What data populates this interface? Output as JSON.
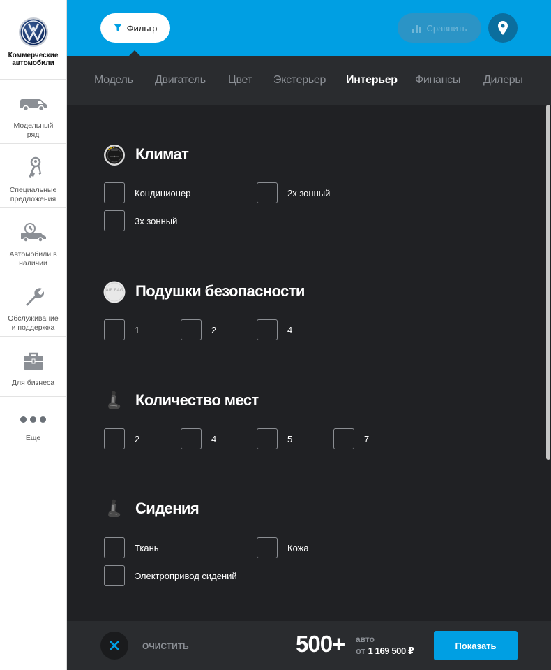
{
  "brand": {
    "name": "Коммерческие автомобили"
  },
  "sidebar": {
    "items": [
      {
        "label": "Модельный ряд",
        "icon": "van-icon"
      },
      {
        "label": "Специальные предложения",
        "icon": "keys-icon"
      },
      {
        "label": "Автомобили в наличии",
        "icon": "car-clock-icon"
      },
      {
        "label": "Обслуживание и поддержка",
        "icon": "wrench-icon"
      },
      {
        "label": "Для бизнеса",
        "icon": "briefcase-icon"
      },
      {
        "label": "Еще",
        "icon": "more-dots-icon"
      }
    ]
  },
  "topbar": {
    "filter_label": "Фильтр",
    "compare_label": "Сравнить",
    "accent_color": "#009fe3"
  },
  "tabs": [
    "Модель",
    "Двигатель",
    "Цвет",
    "Экстерьер",
    "Интерьер",
    "Финансы",
    "Дилеры"
  ],
  "active_tab": "Интерьер",
  "sections": [
    {
      "title": "Климат",
      "icon": "climate-control-icon",
      "options": [
        "Кондиционер",
        "2х зонный",
        "3х зонный"
      ]
    },
    {
      "title": "Подушки безопасности",
      "icon": "airbag-icon",
      "icon_text": "AIR BAG",
      "options": [
        "1",
        "2",
        "4"
      ]
    },
    {
      "title": "Количество мест",
      "icon": "seat-icon",
      "options": [
        "2",
        "4",
        "5",
        "7"
      ]
    },
    {
      "title": "Сидения",
      "icon": "seat-icon",
      "options": [
        "Ткань",
        "Кожа",
        "Электропривод сидений"
      ]
    }
  ],
  "bottom": {
    "clear_label": "ОЧИСТИТЬ",
    "count": "500+",
    "count_unit": "авто",
    "price_prefix": "от",
    "price": "1 169 500 ₽",
    "show_label": "Показать"
  }
}
